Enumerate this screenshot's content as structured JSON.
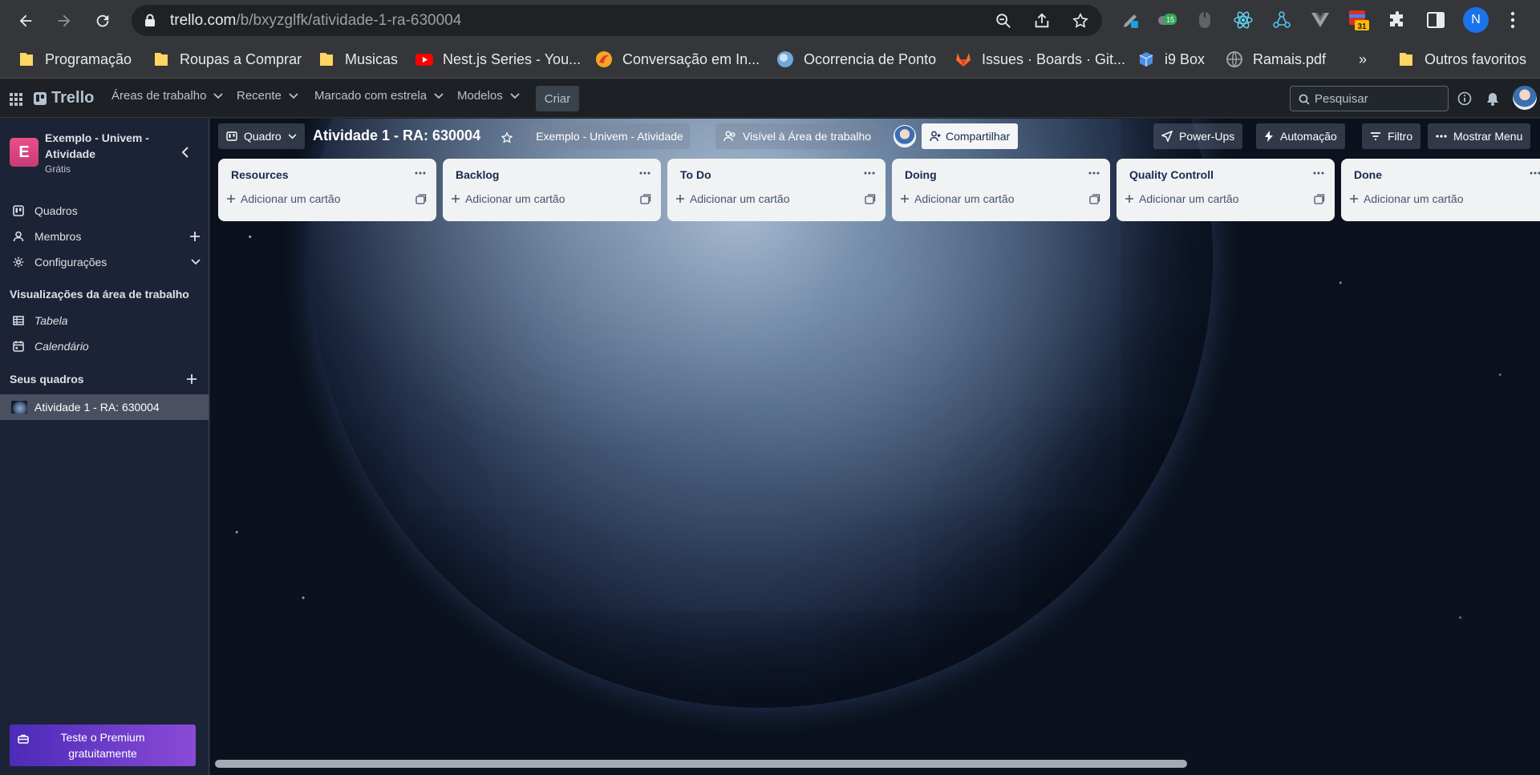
{
  "browser": {
    "url_host": "trello.com",
    "url_path": "/b/bxyzglfk/atividade-1-ra-630004",
    "profile_initial": "N",
    "calendar_badge": "31",
    "ext_badge": "15",
    "bookmarks": [
      {
        "label": "Programação",
        "icon": "folder-icon"
      },
      {
        "label": "Roupas a Comprar",
        "icon": "folder-icon"
      },
      {
        "label": "Musicas",
        "icon": "folder-icon"
      },
      {
        "label": "Nest.js Series - You...",
        "icon": "youtube-icon"
      },
      {
        "label": "Conversação em In...",
        "icon": "site-icon"
      },
      {
        "label": "Ocorrencia de Ponto",
        "icon": "site-icon"
      },
      {
        "label": "Issues · Boards · Git...",
        "icon": "gitlab-icon"
      },
      {
        "label": "i9 Box",
        "icon": "box-icon"
      },
      {
        "label": "Ramais.pdf",
        "icon": "globe-icon"
      }
    ],
    "overflow": "»",
    "other_bookmarks": "Outros favoritos"
  },
  "trello_header": {
    "logo": "Trello",
    "menus": [
      "Áreas de trabalho",
      "Recente",
      "Marcado com estrela",
      "Modelos"
    ],
    "create": "Criar",
    "search_placeholder": "Pesquisar"
  },
  "sidebar": {
    "workspace_initial": "E",
    "workspace_name": "Exemplo - Univem - Atividade",
    "workspace_plan": "Grátis",
    "items": [
      {
        "label": "Quadros"
      },
      {
        "label": "Membros"
      },
      {
        "label": "Configurações"
      }
    ],
    "views_title": "Visualizações da área de trabalho",
    "views": [
      {
        "label": "Tabela"
      },
      {
        "label": "Calendário"
      }
    ],
    "boards_title": "Seus quadros",
    "boards": [
      {
        "label": "Atividade 1 - RA: 630004"
      }
    ],
    "premium_line1": "Teste o Premium",
    "premium_line2": "gratuitamente"
  },
  "board": {
    "view": "Quadro",
    "title": "Atividade 1 - RA: 630004",
    "workspace": "Exemplo - Univem - Atividade",
    "visibility": "Visível à Área de trabalho",
    "share": "Compartilhar",
    "powerups": "Power-Ups",
    "automation": "Automação",
    "filter": "Filtro",
    "menu": "Mostrar Menu",
    "add_card": "Adicionar um cartão",
    "lists": [
      {
        "title": "Resources"
      },
      {
        "title": "Backlog"
      },
      {
        "title": "To Do"
      },
      {
        "title": "Doing"
      },
      {
        "title": "Quality Controll"
      },
      {
        "title": "Done"
      }
    ]
  },
  "colors": {
    "chrome": "#35363a",
    "trello_header": "#1d2125",
    "sidebar": "#1d2336",
    "list": "#f1f2f4",
    "workspace_badge": "#ec4f8a",
    "premium": "#6f3fd0"
  }
}
